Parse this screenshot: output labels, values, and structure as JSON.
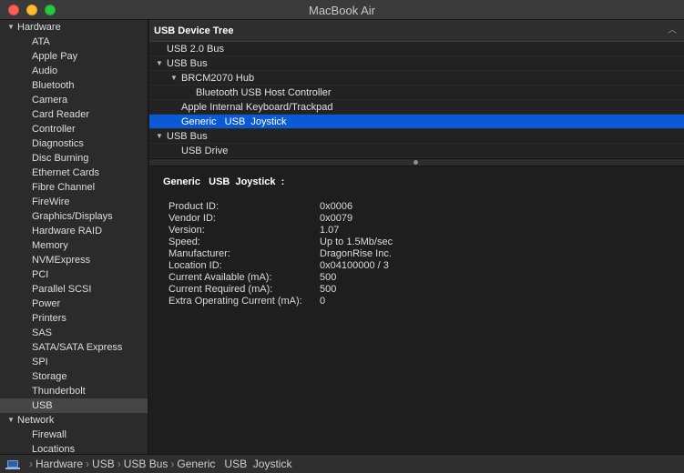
{
  "window": {
    "title": "MacBook Air"
  },
  "sidebar": {
    "hardware_label": "Hardware",
    "hardware_items": [
      "ATA",
      "Apple Pay",
      "Audio",
      "Bluetooth",
      "Camera",
      "Card Reader",
      "Controller",
      "Diagnostics",
      "Disc Burning",
      "Ethernet Cards",
      "Fibre Channel",
      "FireWire",
      "Graphics/Displays",
      "Hardware RAID",
      "Memory",
      "NVMExpress",
      "PCI",
      "Parallel SCSI",
      "Power",
      "Printers",
      "SAS",
      "SATA/SATA Express",
      "SPI",
      "Storage",
      "Thunderbolt",
      "USB"
    ],
    "selected_item": "USB",
    "network_label": "Network",
    "network_items": [
      "Firewall",
      "Locations"
    ]
  },
  "tree": {
    "header": "USB Device Tree",
    "rows": [
      "USB 2.0 Bus",
      "USB Bus",
      "BRCM2070 Hub",
      "Bluetooth USB Host Controller",
      "Apple Internal Keyboard/Trackpad",
      "Generic   USB  Joystick",
      "USB Bus",
      "USB Drive"
    ]
  },
  "detail": {
    "title": "Generic   USB  Joystick  :",
    "properties": [
      {
        "key": "Product ID:",
        "value": "0x0006"
      },
      {
        "key": "Vendor ID:",
        "value": "0x0079"
      },
      {
        "key": "Version:",
        "value": "1.07"
      },
      {
        "key": "Speed:",
        "value": "Up to 1.5Mb/sec"
      },
      {
        "key": "Manufacturer:",
        "value": "DragonRise Inc."
      },
      {
        "key": "Location ID:",
        "value": "0x04100000 / 3"
      },
      {
        "key": "Current Available (mA):",
        "value": "500"
      },
      {
        "key": "Current Required (mA):",
        "value": "500"
      },
      {
        "key": "Extra Operating Current (mA):",
        "value": "0"
      }
    ]
  },
  "pathbar": {
    "crumbs": [
      "Hardware",
      "USB",
      "USB Bus",
      "Generic   USB  Joystick"
    ]
  },
  "icons": {
    "disclosure": "disclosure-triangle-icon",
    "computer": "laptop-icon"
  },
  "colors": {
    "selection": "#0a5ad6",
    "sidebar_selection": "#464646"
  }
}
